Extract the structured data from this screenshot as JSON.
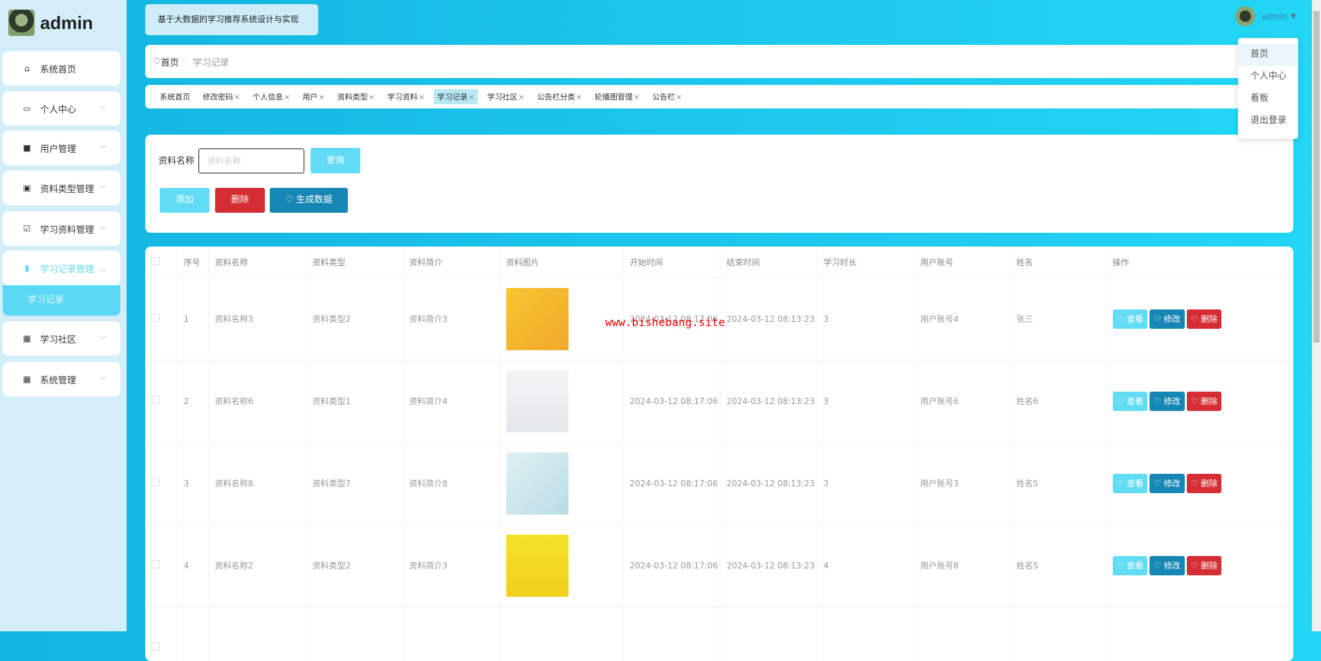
{
  "sidebar": {
    "username": "admin",
    "items": [
      {
        "label": "系统首页",
        "icon": "home-icon"
      },
      {
        "label": "个人中心",
        "icon": "card-icon"
      },
      {
        "label": "用户管理",
        "icon": "ticket-icon"
      },
      {
        "label": "资料类型管理",
        "icon": "chart-icon"
      },
      {
        "label": "学习资料管理",
        "icon": "clipboard-icon"
      },
      {
        "label": "学习记录管理",
        "icon": "bar-icon"
      },
      {
        "label": "学习社区",
        "icon": "grid-icon"
      },
      {
        "label": "系统管理",
        "icon": "grid-icon"
      }
    ],
    "sub_item": "学习记录"
  },
  "header": {
    "title": "基于大数据的学习推荐系统设计与实现",
    "user": "admin",
    "dropdown": [
      "首页",
      "个人中心",
      "看板",
      "退出登录"
    ]
  },
  "breadcrumb": {
    "home": "首页",
    "current": "学习记录"
  },
  "tabs": [
    "系统首页",
    "修改密码",
    "个人信息",
    "用户",
    "资料类型",
    "学习资料",
    "学习记录",
    "学习社区",
    "公告栏分类",
    "轮播图管理",
    "公告栏"
  ],
  "search": {
    "label": "资料名称",
    "placeholder": "资料名称",
    "query": "查询",
    "add": "添加",
    "delete": "删除",
    "generate": "生成数据"
  },
  "table": {
    "headers": [
      "序号",
      "资料名称",
      "资料类型",
      "资料简介",
      "资料图片",
      "开始时间",
      "结束时间",
      "学习时长",
      "用户账号",
      "姓名",
      "操作"
    ],
    "rows": [
      [
        "1",
        "资料名称3",
        "资料类型2",
        "资料简介3",
        "",
        "2024-03-12 08:17:06",
        "2024-03-12 08:13:23",
        "3",
        "用户账号4",
        "张三"
      ],
      [
        "2",
        "资料名称6",
        "资料类型1",
        "资料简介4",
        "",
        "2024-03-12 08:17:06",
        "2024-03-12 08:13:23",
        "3",
        "用户账号6",
        "姓名6"
      ],
      [
        "3",
        "资料名称8",
        "资料类型7",
        "资料简介8",
        "",
        "2024-03-12 08:17:06",
        "2024-03-12 08:13:23",
        "3",
        "用户账号3",
        "姓名5"
      ],
      [
        "4",
        "资料名称2",
        "资料类型2",
        "资料简介3",
        "",
        "2024-03-12 08:17:06",
        "2024-03-12 08:13:23",
        "4",
        "用户账号8",
        "姓名5"
      ]
    ],
    "actions": {
      "view": "查看",
      "edit": "修改",
      "delete": "删除"
    }
  },
  "watermark": "www.bishebang.site"
}
